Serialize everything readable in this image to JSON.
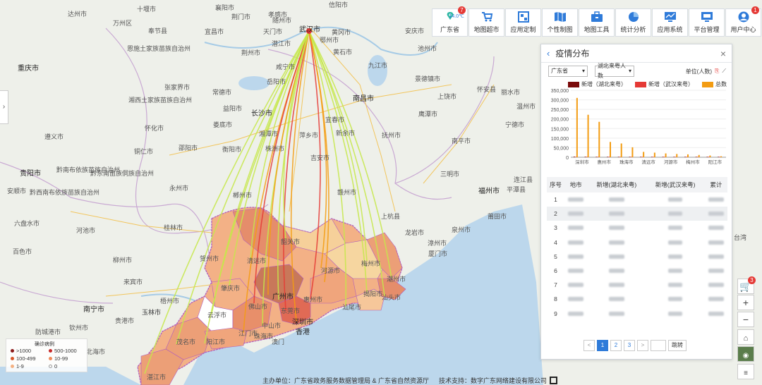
{
  "toolbar": {
    "items": [
      {
        "label": "广东省",
        "weather": "14.0℃",
        "badge": "7"
      },
      {
        "label": "地图超市"
      },
      {
        "label": "应用定制"
      },
      {
        "label": "个性制图"
      },
      {
        "label": "地图工具"
      },
      {
        "label": "统计分析"
      },
      {
        "label": "应用系统"
      },
      {
        "label": "平台管理"
      },
      {
        "label": "用户中心",
        "badge": "1"
      }
    ]
  },
  "panel": {
    "title": "疫情分布",
    "filter_region": "广东省",
    "filter_metric": "湖北来粤人数",
    "unit_label": "单位(人数)",
    "legend": [
      {
        "name": "新增（湖北来粤）",
        "color": "#7a0a0a"
      },
      {
        "name": "新增（武汉来粤）",
        "color": "#e53935"
      },
      {
        "name": "总数",
        "color": "#f39c12"
      }
    ],
    "table": {
      "headers": [
        "序号",
        "地市",
        "新增(湖北来粤)",
        "新增(武汉来粤)",
        "累计"
      ],
      "rows": [
        "1",
        "2",
        "3",
        "4",
        "5",
        "6",
        "7",
        "8",
        "9"
      ]
    },
    "pager": {
      "prev": "<",
      "pages": [
        "1",
        "2",
        "3"
      ],
      "next": ">",
      "go": "跳转"
    }
  },
  "chart_data": {
    "type": "bar",
    "categories": [
      "深圳市",
      "",
      "惠州市",
      "",
      "珠海市",
      "",
      "清远市",
      "",
      "河源市",
      "",
      "梅州市",
      "",
      "阳江市",
      ""
    ],
    "series": [
      {
        "name": "新增（湖北来粤）",
        "values": [
          3000,
          2500,
          2000,
          1200,
          1000,
          900,
          700,
          600,
          500,
          400,
          300,
          250,
          200,
          150
        ]
      },
      {
        "name": "新增（武汉来粤）",
        "values": [
          1500,
          1200,
          1000,
          700,
          500,
          450,
          350,
          300,
          250,
          200,
          150,
          120,
          100,
          80
        ]
      },
      {
        "name": "总数",
        "values": [
          310000,
          222000,
          185000,
          80000,
          72000,
          52000,
          28000,
          24000,
          20000,
          17000,
          15000,
          12000,
          9000,
          5000
        ]
      }
    ],
    "yticks": [
      "350,000",
      "300,000",
      "250,000",
      "200,000",
      "150,000",
      "100,000",
      "50,000",
      "0"
    ],
    "ylim": [
      0,
      350000
    ]
  },
  "map": {
    "labels": {
      "wuhan": "武汉市",
      "changsha": "长沙市",
      "nanchang": "南昌市",
      "guiyang": "贵阳市",
      "fuzhou": "福州市",
      "chongqing": "重庆市",
      "nanning": "南宁市",
      "guangzhou": "广州市",
      "shenzhen": "深圳市",
      "hongkong": "香港",
      "macau": "澳门",
      "zhuhai": "珠海市",
      "shantou": "汕头市",
      "meizhou": "梅州市",
      "shaoguan": "韶关市",
      "qingyuan": "清远市",
      "heyuan": "河源市",
      "zhaoqing": "肇庆市",
      "foshan": "佛山市",
      "jiangmen": "江门市",
      "zhongshan": "中山市",
      "dongguan": "东莞市",
      "huizhou": "惠州市",
      "shanwei": "汕尾市",
      "jieyang": "揭阳市",
      "chaozhou": "潮州市",
      "yunfu": "云浮市",
      "maoming": "茂名市",
      "yangjiang": "阳江市",
      "zhanjiang": "湛江市",
      "yichang": "宜昌市",
      "xiamen": "厦门市",
      "quanzhou": "泉州市",
      "guilin": "桂林市",
      "liuzhou": "柳州市",
      "ganzhou": "赣州市",
      "jian": "吉安市",
      "yongzhou": "永州市",
      "chenzhou": "郴州市",
      "hengyang": "衡阳市",
      "jiujiang": "九江市",
      "huangshi": "黄石市",
      "yueyang": "岳阳市",
      "huaihua": "怀化市",
      "shaoyang": "邵阳市",
      "zhangjiajie": "张家界市",
      "changde": "常德市",
      "yiyang": "益阳市",
      "loudi": "娄底市",
      "xiangtan": "湘潭市",
      "zhuzhou": "株洲市",
      "pingxiang": "萍乡市",
      "xinyu": "新余市",
      "yichun": "宜春市",
      "fuzhou_jx": "抚州市",
      "nanping": "南平市",
      "sanming": "三明市",
      "longyan": "龙岩市",
      "zhangzhou": "漳州市",
      "putian": "莆田市",
      "ningde": "宁德市",
      "hezhou": "贺州市",
      "wuzhou": "梧州市",
      "yulin": "玉林市",
      "guigang": "贵港市",
      "qinzhou": "钦州市",
      "beihai": "北海市",
      "fangchenggang": "防城港市",
      "hechi": "河池市",
      "laibin": "来宾市",
      "baise": "百色市",
      "anshun": "安顺市",
      "duyun_label": "黔南布依族苗族自治州",
      "qiandongnan": "黔东南苗族侗族自治州",
      "qianxinan": "黔西南布依族苗族自治州",
      "tongren": "铜仁市",
      "zunyi": "遵义市",
      "enshi": "恩施土家族苗族自治州",
      "xiangxi": "湘西土家族苗族自治州",
      "jingzhou": "荆州市",
      "xianning": "咸宁市",
      "jingmen": "荆门市",
      "xiaogan": "孝感市",
      "suizhou": "随州市",
      "huanggang": "黄冈市",
      "ezhou": "鄂州市",
      "tianmen": "天门市",
      "xiangyang": "襄阳市",
      "shiyan": "十堰市",
      "anqing": "安庆市",
      "chizhou": "池州市",
      "jingdezhen": "景德镇市",
      "shangrao": "上饶市",
      "yingtan": "鹰潭市",
      "lishui": "丽水市",
      "wenzhou": "温州市",
      "qianjiang": "潜江市",
      "xinyang": "信阳市",
      "liupanshui": "六盘水市",
      "fengjie": "奉节县",
      "shanghang": "上杭县",
      "lianjiang": "连江县",
      "pingtan": "平潭县",
      "huaian": "怀安县",
      "taiwan": "台湾",
      "dazhou": "达州市",
      "wanzhou": "万州区",
      "yulin_gx": "玉林市"
    }
  },
  "legend": {
    "title": "确诊病例",
    "items": [
      ">1000",
      "500-1000",
      "100-499",
      "10-99",
      "1-9",
      "0"
    ]
  },
  "footer": {
    "host": "主办单位：广东省政务服务数据管理局 & 广东省自然资源厅",
    "tech": "技术支持：数字广东网络建设有限公司"
  },
  "colors": {
    "accent": "#2f7bd9",
    "gd_dark": "#e07a5f",
    "gd_mid": "#f0a57c",
    "gd_light": "#f6d09a",
    "line_yellow": "#c6e84a",
    "line_red": "#e53935"
  }
}
